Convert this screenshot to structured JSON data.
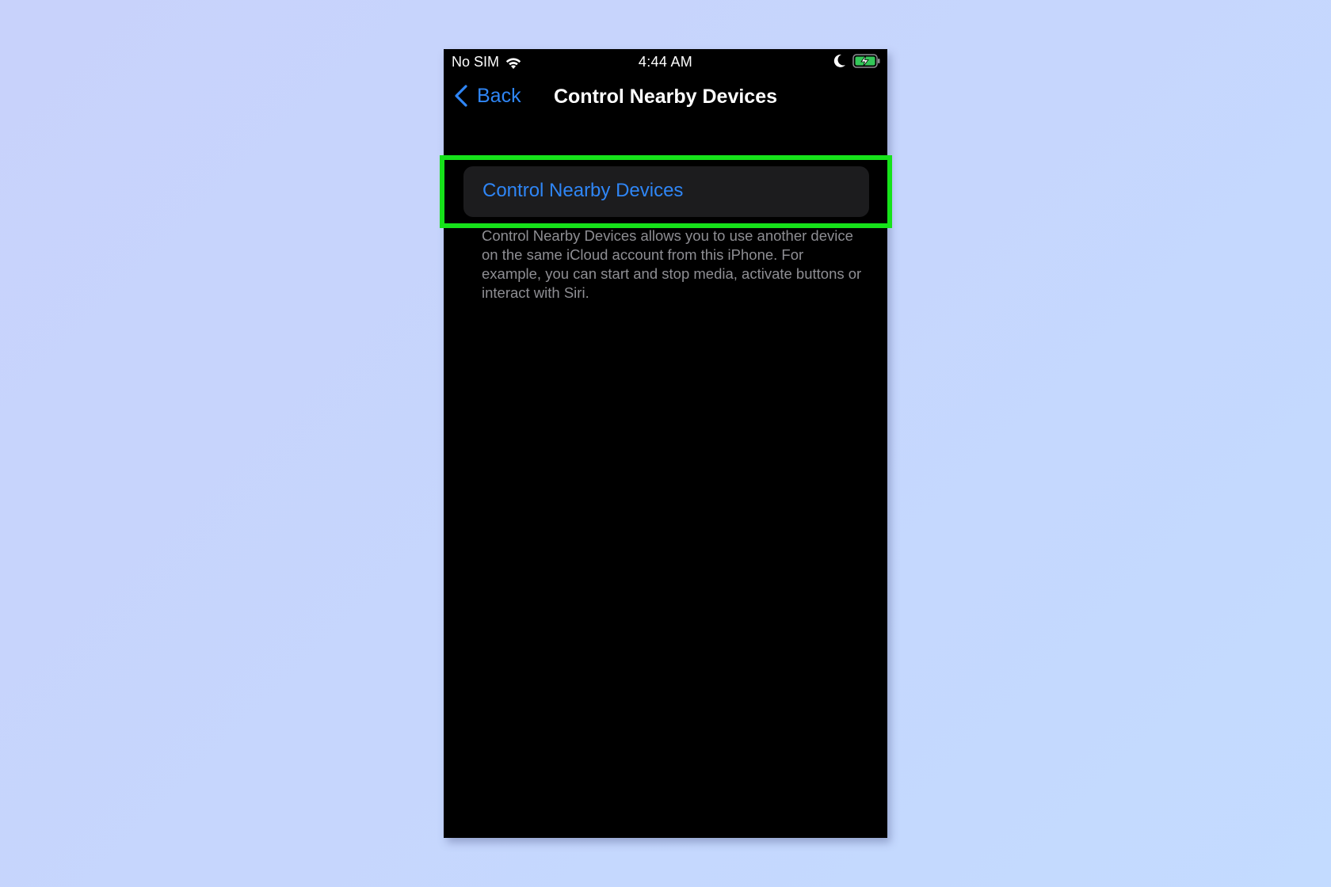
{
  "status_bar": {
    "carrier": "No SIM",
    "time": "4:44 AM",
    "icons": {
      "wifi": "wifi-icon",
      "moon": "moon-icon",
      "battery": "battery-charging-icon"
    }
  },
  "nav": {
    "back_label": "Back",
    "title": "Control Nearby Devices"
  },
  "setting": {
    "label": "Control Nearby Devices",
    "footer": "Control Nearby Devices allows you to use another device on the same iCloud account from this iPhone. For example, you can start and stop media, activate buttons or interact with Siri."
  },
  "colors": {
    "accent": "#2f86f6",
    "highlight": "#16e21a",
    "background": "#000000",
    "row_background": "#1c1c1e",
    "battery": "#34c759"
  }
}
